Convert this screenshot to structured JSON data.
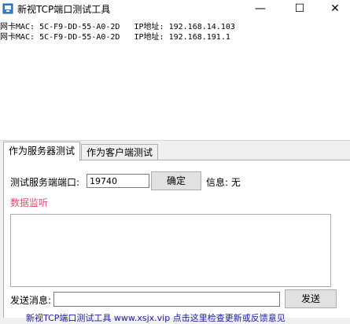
{
  "window": {
    "title": "新视TCP端口测试工具",
    "minimize_glyph": "—",
    "maximize_glyph": "☐",
    "close_glyph": "✕"
  },
  "info": {
    "lines": [
      "网卡MAC: 5C-F9-DD-55-A0-2D   IP地址: 192.168.14.103",
      "网卡MAC: 5C-F9-DD-55-A0-2D   IP地址: 192.168.191.1"
    ]
  },
  "tabs": [
    {
      "label": "作为服务器测试"
    },
    {
      "label": "作为客户端测试"
    }
  ],
  "server": {
    "port_label": "测试服务端端口:",
    "port_value": "19740",
    "confirm_label": "确定",
    "info_label": "信息: 无",
    "data_monitor_label": "数据监听",
    "send_label": "发送消息:",
    "send_value": "",
    "send_button": "发送"
  },
  "footer": {
    "text": "新视TCP端口测试工具 www.xsjx.vip  点击这里检查更新或反馈意见"
  },
  "colors": {
    "data_monitor": "#e0506e",
    "footer_link": "#1a1aa6"
  }
}
